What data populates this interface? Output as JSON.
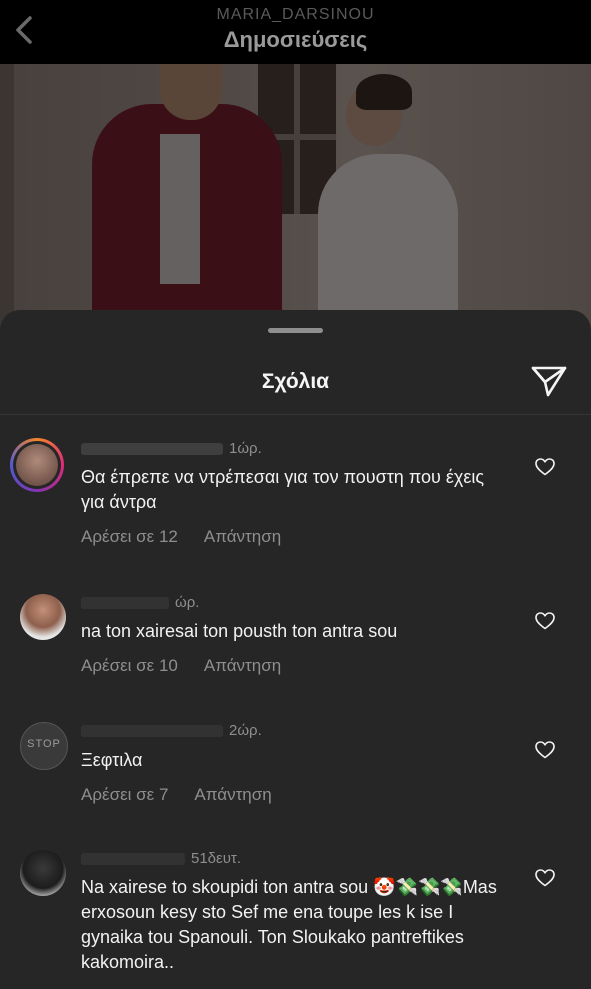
{
  "header": {
    "username": "MARIA_DARSINOU",
    "title": "Δημοσιεύσεις"
  },
  "sheet": {
    "title": "Σχόλια"
  },
  "comments": [
    {
      "time": "1ώρ.",
      "text": "Θα έπρεπε να ντρέπεσαι για τον πουστη που έχεις για άντρα",
      "likes": "Αρέσει σε 12",
      "reply": "Απάντηση"
    },
    {
      "time": "ώρ.",
      "text": "na ton xairesai ton pousth ton antra sou",
      "likes": "Αρέσει σε 10",
      "reply": "Απάντηση"
    },
    {
      "time": "2ώρ.",
      "text": "Ξεφτιλα",
      "likes": "Αρέσει σε 7",
      "reply": "Απάντηση",
      "avatar_text": "STOP"
    },
    {
      "time": "51δευτ.",
      "text": "Na xairese to skoupidi ton antra sou 🤡💸💸💸Mas erxosoun kesy sto Sef me ena toupe les k ise I gynaika tou Spanouli. Ton Sloukako pantreftikes kakomoira.."
    }
  ],
  "icons": {
    "back": "chevron-left-icon",
    "send": "paper-plane-icon",
    "like": "heart-outline-icon"
  },
  "colors": {
    "sheet_bg": "#262626",
    "muted_text": "#8e8e8e",
    "story_ring": "#c13584"
  }
}
